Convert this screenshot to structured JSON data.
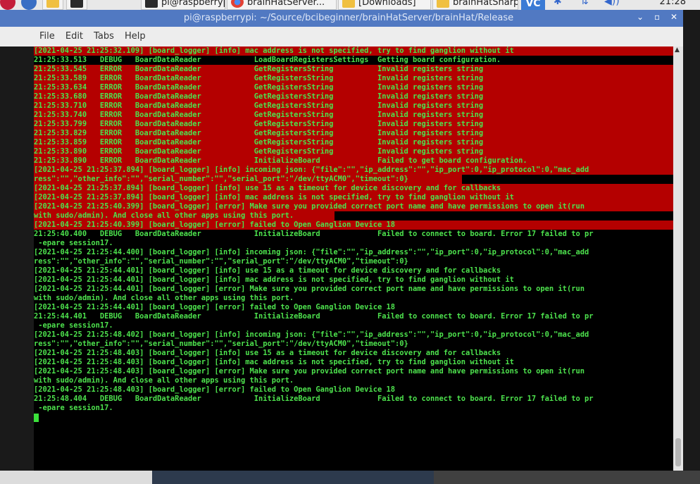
{
  "taskbar": {
    "items": [
      {
        "label": "pi@raspberrypi:..."
      },
      {
        "label": "brainHatServer..."
      },
      {
        "label": "[Downloads]"
      },
      {
        "label": "brainHatSharp..."
      }
    ],
    "vc_label": "VC",
    "clock": "21:28"
  },
  "window": {
    "title": "pi@raspberrypi: ~/Source/bcibeginner/brainHatServer/brainHat/Release",
    "controls": [
      "⌄",
      "▫",
      "✕"
    ],
    "menu": [
      "File",
      "Edit",
      "Tabs",
      "Help"
    ]
  },
  "terminal": {
    "lines": [
      {
        "text": "[2021-04-25 21:25:32.109] [board_logger] [info] mac address is not specified, try to find ganglion without it",
        "hl": 1
      },
      {
        "text": "21:25:33.513   DEBUG   BoardDataReader            LoadBoardRegistersSettings  Getting board configuration.",
        "hl": 0
      },
      {
        "text": "21:25:33.545   ERROR   BoardDataReader            GetRegistersString          Invalid registers string",
        "hl": 1
      },
      {
        "text": "21:25:33.589   ERROR   BoardDataReader            GetRegistersString          Invalid registers string",
        "hl": 1
      },
      {
        "text": "21:25:33.634   ERROR   BoardDataReader            GetRegistersString          Invalid registers string",
        "hl": 1
      },
      {
        "text": "21:25:33.680   ERROR   BoardDataReader            GetRegistersString          Invalid registers string",
        "hl": 1
      },
      {
        "text": "21:25:33.710   ERROR   BoardDataReader            GetRegistersString          Invalid registers string",
        "hl": 1
      },
      {
        "text": "21:25:33.740   ERROR   BoardDataReader            GetRegistersString          Invalid registers string",
        "hl": 1
      },
      {
        "text": "21:25:33.799   ERROR   BoardDataReader            GetRegistersString          Invalid registers string",
        "hl": 1
      },
      {
        "text": "21:25:33.829   ERROR   BoardDataReader            GetRegistersString          Invalid registers string",
        "hl": 1
      },
      {
        "text": "21:25:33.859   ERROR   BoardDataReader            GetRegistersString          Invalid registers string",
        "hl": 1
      },
      {
        "text": "21:25:33.890   ERROR   BoardDataReader            GetRegistersString          Invalid registers string",
        "hl": 1
      },
      {
        "text": "21:25:33.890   ERROR   BoardDataReader            InitializeBoard             Failed to get board configuration.",
        "hl": 1
      },
      {
        "text": "[2021-04-25 21:25:37.894] [board_logger] [info] incoming json: {\"file\":\"\",\"ip_address\":\"\",\"ip_port\":0,\"ip_protocol\":0,\"mac_add",
        "hl": 1
      },
      {
        "text": "ress\":\"\",\"other_info\":\"\",\"serial_number\":\"\",\"serial_port\":\"/dev/ttyACM0\",\"timeout\":0}",
        "hl": 0.67
      },
      {
        "text": "[2021-04-25 21:25:37.894] [board_logger] [info] use 15 as a timeout for device discovery and for callbacks",
        "hl": 1
      },
      {
        "text": "[2021-04-25 21:25:37.894] [board_logger] [info] mac address is not specified, try to find ganglion without it",
        "hl": 1
      },
      {
        "text": "[2021-04-25 21:25:40.399] [board_logger] [error] Make sure you provided correct port name and have permissions to open it(run",
        "hl": 1
      },
      {
        "text": "with sudo/admin). And close all other apps using this port.",
        "hl": 0.47
      },
      {
        "text": "[2021-04-25 21:25:40.399] [board_logger] [error] failed to Open Ganglion Device 18",
        "hl": 1
      },
      {
        "text": "21:25:40.400   DEBUG   BoardDataReader            InitializeBoard             Failed to connect to board. Error 17 failed to pr",
        "hl": 0
      },
      {
        "text": " -epare session17.",
        "hl": 0
      },
      {
        "text": "[2021-04-25 21:25:44.400] [board_logger] [info] incoming json: {\"file\":\"\",\"ip_address\":\"\",\"ip_port\":0,\"ip_protocol\":0,\"mac_add",
        "hl": 0
      },
      {
        "text": "ress\":\"\",\"other_info\":\"\",\"serial_number\":\"\",\"serial_port\":\"/dev/ttyACM0\",\"timeout\":0}",
        "hl": 0
      },
      {
        "text": "[2021-04-25 21:25:44.401] [board_logger] [info] use 15 as a timeout for device discovery and for callbacks",
        "hl": 0
      },
      {
        "text": "[2021-04-25 21:25:44.401] [board_logger] [info] mac address is not specified, try to find ganglion without it",
        "hl": 0
      },
      {
        "text": "[2021-04-25 21:25:44.401] [board_logger] [error] Make sure you provided correct port name and have permissions to open it(run",
        "hl": 0
      },
      {
        "text": "with sudo/admin). And close all other apps using this port.",
        "hl": 0
      },
      {
        "text": "[2021-04-25 21:25:44.401] [board_logger] [error] failed to Open Ganglion Device 18",
        "hl": 0
      },
      {
        "text": "21:25:44.401   DEBUG   BoardDataReader            InitializeBoard             Failed to connect to board. Error 17 failed to pr",
        "hl": 0
      },
      {
        "text": " -epare session17.",
        "hl": 0
      },
      {
        "text": "[2021-04-25 21:25:48.402] [board_logger] [info] incoming json: {\"file\":\"\",\"ip_address\":\"\",\"ip_port\":0,\"ip_protocol\":0,\"mac_add",
        "hl": 0
      },
      {
        "text": "ress\":\"\",\"other_info\":\"\",\"serial_number\":\"\",\"serial_port\":\"/dev/ttyACM0\",\"timeout\":0}",
        "hl": 0
      },
      {
        "text": "[2021-04-25 21:25:48.403] [board_logger] [info] use 15 as a timeout for device discovery and for callbacks",
        "hl": 0
      },
      {
        "text": "[2021-04-25 21:25:48.403] [board_logger] [info] mac address is not specified, try to find ganglion without it",
        "hl": 0
      },
      {
        "text": "[2021-04-25 21:25:48.403] [board_logger] [error] Make sure you provided correct port name and have permissions to open it(run",
        "hl": 0
      },
      {
        "text": "with sudo/admin). And close all other apps using this port.",
        "hl": 0
      },
      {
        "text": "[2021-04-25 21:25:48.403] [board_logger] [error] failed to Open Ganglion Device 18",
        "hl": 0
      },
      {
        "text": "21:25:48.404   DEBUG   BoardDataReader            InitializeBoard             Failed to connect to board. Error 17 failed to pr",
        "hl": 0
      },
      {
        "text": " -epare session17.",
        "hl": 0
      }
    ]
  },
  "colors": {
    "text": "#4de24d",
    "highlight": "#b40000",
    "titlebar": "#5179c2"
  }
}
